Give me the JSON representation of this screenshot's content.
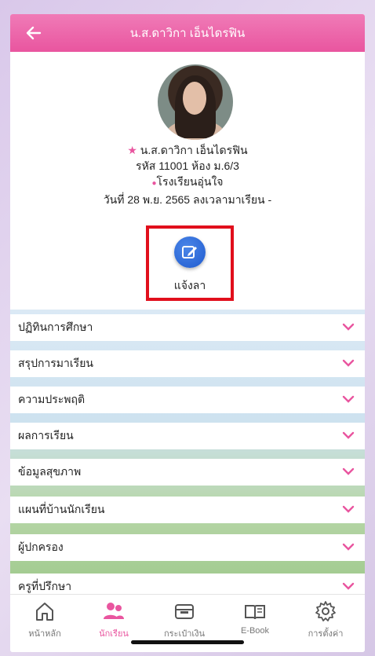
{
  "header": {
    "title": "น.ส.ดาวิกา เอ็นไดรฟิน"
  },
  "profile": {
    "name_line": "น.ส.ดาวิกา เอ็นไดรฟิน",
    "id_line": "รหัส 11001 ห้อง ม.6/3",
    "school_line": "โรงเรียนอุ่นใจ",
    "date_line": "วันที่ 28 พ.ย. 2565  ลงเวลามาเรียน -"
  },
  "leave": {
    "label": "แจ้งลา"
  },
  "accordion": {
    "items": [
      {
        "label": "ปฏิทินการศึกษา"
      },
      {
        "label": "สรุปการมาเรียน"
      },
      {
        "label": "ความประพฤติ"
      },
      {
        "label": "ผลการเรียน"
      },
      {
        "label": "ข้อมูลสุขภาพ"
      },
      {
        "label": "แผนที่บ้านนักเรียน"
      },
      {
        "label": "ผู้ปกครอง"
      },
      {
        "label": "ครูที่ปรึกษา"
      }
    ]
  },
  "nav": {
    "items": [
      {
        "label": "หน้าหลัก",
        "icon": "home-icon"
      },
      {
        "label": "นักเรียน",
        "icon": "students-icon",
        "active": true
      },
      {
        "label": "กระเป๋าเงิน",
        "icon": "wallet-icon"
      },
      {
        "label": "E-Book",
        "icon": "book-icon"
      },
      {
        "label": "การตั้งค่า",
        "icon": "gear-icon"
      }
    ]
  },
  "colors": {
    "accent": "#e9559f",
    "leave_button": "#1f5bcf",
    "highlight_box": "#e10f1c"
  }
}
